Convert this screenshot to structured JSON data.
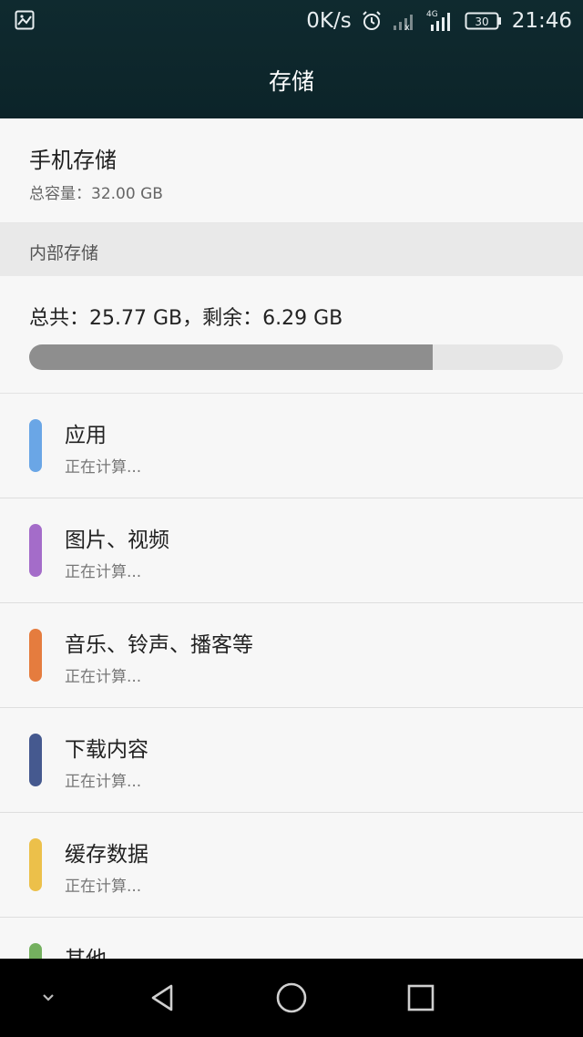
{
  "status_bar": {
    "net_speed": "0K/s",
    "network_type": "4G",
    "battery": "30",
    "time": "21:46",
    "icons": [
      "image-icon",
      "alarm-icon",
      "signal-weak-icon",
      "signal-4g-icon",
      "battery-icon"
    ]
  },
  "header": {
    "title": "存储"
  },
  "phone_storage": {
    "title": "手机存储",
    "capacity": "总容量：32.00  GB"
  },
  "internal": {
    "section_label": "内部存储",
    "summary": "总共：25.77 GB，剩余：6.29 GB",
    "used_fraction": 0.756
  },
  "categories": [
    {
      "label": "应用",
      "status": "正在计算...",
      "color": "#6aa6e6"
    },
    {
      "label": "图片、视频",
      "status": "正在计算...",
      "color": "#a46cc9"
    },
    {
      "label": "音乐、铃声、播客等",
      "status": "正在计算...",
      "color": "#e57c3e"
    },
    {
      "label": "下载内容",
      "status": "正在计算...",
      "color": "#45598f"
    },
    {
      "label": "缓存数据",
      "status": "正在计算...",
      "color": "#ecc04a"
    },
    {
      "label": "其他",
      "status": "",
      "color": "#74b05f"
    }
  ],
  "nav_bar": {
    "icons": [
      "chevron-down-icon",
      "back-icon",
      "home-icon",
      "recents-icon"
    ]
  }
}
